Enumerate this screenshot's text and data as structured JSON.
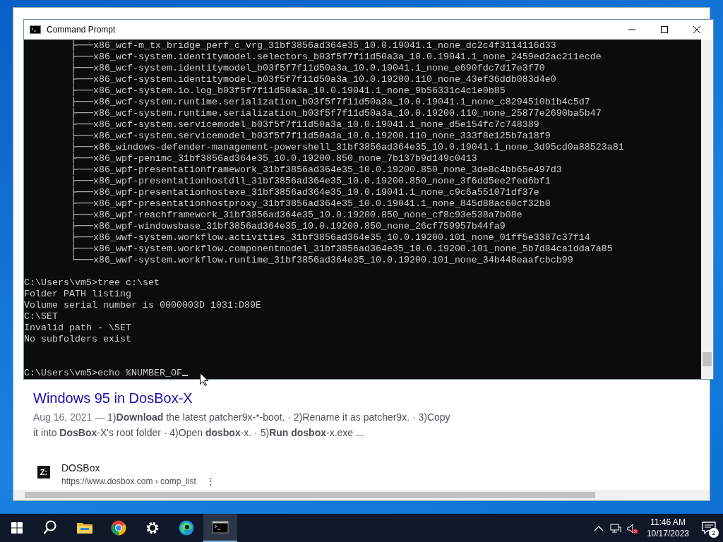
{
  "console_window": {
    "title": "Command Prompt",
    "tree_lines": [
      "├───x86_wcf-m_tx_bridge_perf_c_vrg_31bf3856ad364e35_10.0.19041.1_none_dc2c4f3114116d33",
      "├───x86_wcf-system.identitymodel.selectors_b03f5f7f11d50a3a_10.0.19041.1_none_2459ed2ac211ecde",
      "├───x86_wcf-system.identitymodel_b03f5f7f11d50a3a_10.0.19041.1_none_e690fdc7d17e3f70",
      "├───x86_wcf-system.identitymodel_b03f5f7f11d50a3a_10.0.19200.110_none_43ef36ddb083d4e0",
      "├───x86_wcf-system.io.log_b03f5f7f11d50a3a_10.0.19041.1_none_9b56331c4c1e0b85",
      "├───x86_wcf-system.runtime.serialization_b03f5f7f11d50a3a_10.0.19041.1_none_c8294510b1b4c5d7",
      "├───x86_wcf-system.runtime.serialization_b03f5f7f11d50a3a_10.0.19200.110_none_25877e2690ba5b47",
      "├───x86_wcf-system.servicemodel_b03f5f7f11d50a3a_10.0.19041.1_none_d5e154fc7c748389",
      "├───x86_wcf-system.servicemodel_b03f5f7f11d50a3a_10.0.19200.110_none_333f8e125b7a18f9",
      "├───x86_windows-defender-management-powershell_31bf3856ad364e35_10.0.19041.1_none_3d95cd0a88523a81",
      "├───x86_wpf-penimc_31bf3856ad364e35_10.0.19200.850_none_7b137b9d149c0413",
      "├───x86_wpf-presentationframework_31bf3856ad364e35_10.0.19200.850_none_3de8c4bb65e497d3",
      "├───x86_wpf-presentationhostdll_31bf3856ad364e35_10.0.19200.850_none_3f6dd5ee2fed6bf1",
      "├───x86_wpf-presentationhostexe_31bf3856ad364e35_10.0.19041.1_none_c9c6a551071df37e",
      "├───x86_wpf-presentationhostproxy_31bf3856ad364e35_10.0.19041.1_none_845d88ac60cf32b0",
      "├───x86_wpf-reachframework_31bf3856ad364e35_10.0.19200.850_none_cf8c93e538a7b08e",
      "├───x86_wpf-windowsbase_31bf3856ad364e35_10.0.19200.850_none_26cf759957b44fa9",
      "├───x86_wwf-system.workflow.activities_31bf3856ad364e35_10.0.19200.101_none_01ff5e3387c37f14",
      "├───x86_wwf-system.workflow.componentmodel_31bf3856ad364e35_10.0.19200.101_none_5b7d84ca1dda7a85",
      "└───x86_wwf-system.workflow.runtime_31bf3856ad364e35_10.0.19200.101_none_34b448eaafcbcb99"
    ],
    "output_lines": [
      "C:\\Users\\vm5>tree c:\\set",
      "Folder PATH listing",
      "Volume serial number is 0000003D 1031:D89E",
      "C:\\SET",
      "Invalid path - \\SET",
      "No subfolders exist"
    ],
    "prompt": "C:\\Users\\vm5>echo %NUMBER_OF"
  },
  "browser": {
    "results": [
      {
        "kind": "full",
        "title": "Windows 95 in DosBox-X",
        "date": "Aug 16, 2021 — ",
        "snippet": [
          {
            "text": "1)",
            "bold": false
          },
          {
            "text": "Download",
            "bold": true
          },
          {
            "text": " the latest patcher9x-*-boot. · 2)Rename it as patcher9x. · 3)Copy it into ",
            "bold": false
          },
          {
            "text": "DosBox",
            "bold": true
          },
          {
            "text": "-X's root folder · 4)Open ",
            "bold": false
          },
          {
            "text": "dosbox",
            "bold": true
          },
          {
            "text": "-x. · 5)",
            "bold": false
          },
          {
            "text": "Run dosbox",
            "bold": true
          },
          {
            "text": "-x.exe ...",
            "bold": false
          }
        ]
      },
      {
        "kind": "site",
        "site_name": "DOSBox",
        "favicon_text": "Z:",
        "url": "https://www.dosbox.com › comp_list",
        "menu_glyph": "⋮"
      }
    ]
  },
  "taskbar": {
    "apps": [
      {
        "kind": "search",
        "selected": false
      },
      {
        "kind": "folder",
        "selected": false
      },
      {
        "kind": "chrome",
        "selected": false
      },
      {
        "kind": "settings",
        "selected": false
      },
      {
        "kind": "edge",
        "selected": false
      },
      {
        "kind": "terminal",
        "selected": true
      }
    ],
    "clock": {
      "time": "11:46 AM",
      "date": "10/17/2023"
    },
    "notification_count": "2"
  }
}
